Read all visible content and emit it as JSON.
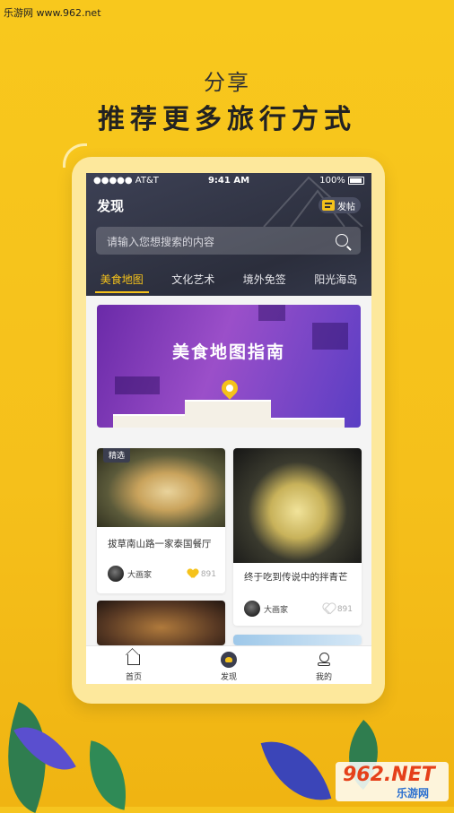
{
  "watermark": {
    "top": "乐游网 www.962.net",
    "bottom_big": "962.NET",
    "bottom_small": "乐游网"
  },
  "headline": {
    "small": "分享",
    "big": "推荐更多旅行方式"
  },
  "status_bar": {
    "carrier": "●●●●● AT&T",
    "time": "9:41 AM",
    "battery": "100%"
  },
  "header": {
    "title": "发现",
    "post_button": "发帖"
  },
  "search": {
    "placeholder": "请输入您想搜索的内容"
  },
  "tabs": [
    {
      "label": "美食地图",
      "active": true
    },
    {
      "label": "文化艺术",
      "active": false
    },
    {
      "label": "境外免签",
      "active": false
    },
    {
      "label": "阳光海岛",
      "active": false
    }
  ],
  "banner": {
    "title": "美食地图指南"
  },
  "cards": [
    {
      "badge": "精选",
      "title": "拔草南山路一家泰国餐厅",
      "author": "大画家",
      "likes": "891",
      "liked": true
    },
    {
      "title": "终于吃到传说中的拌青芒",
      "author": "大画家",
      "likes": "891",
      "liked": false
    }
  ],
  "tabbar": [
    {
      "label": "首页",
      "icon": "home-icon"
    },
    {
      "label": "发现",
      "icon": "discover-icon"
    },
    {
      "label": "我的",
      "icon": "profile-icon"
    }
  ],
  "colors": {
    "accent": "#f5c21b",
    "header_bg": "#2b2e3c",
    "page_bg": "#f6c51f"
  }
}
